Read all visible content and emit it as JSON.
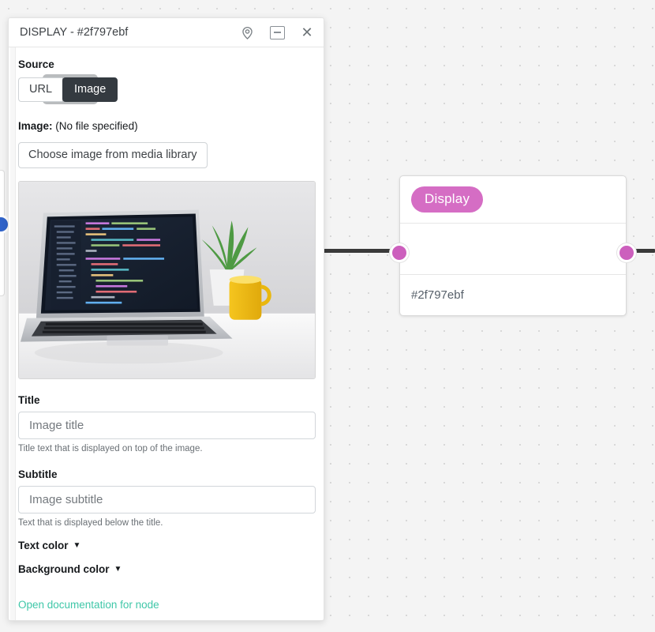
{
  "panel": {
    "title": "DISPLAY - #2f797ebf",
    "icons": {
      "locate": "location-pin-icon",
      "minimize": "minimize-window-icon",
      "close": "close-icon"
    },
    "source": {
      "label": "Source",
      "options": [
        "URL",
        "Image"
      ],
      "selected": "Image"
    },
    "file": {
      "label": "Image:",
      "value": "(No file specified)"
    },
    "media_button": "Choose image from media library",
    "preview": {
      "alt": "Laptop on white desk showing a code editor, with a green potted plant and a yellow mug"
    },
    "title_field": {
      "label": "Title",
      "value": "",
      "placeholder": "Image title",
      "helper": "Title text that is displayed on top of the image."
    },
    "subtitle_field": {
      "label": "Subtitle",
      "value": "",
      "placeholder": "Image subtitle",
      "helper": "Text that is displayed below the title."
    },
    "text_color": {
      "label": "Text color",
      "caret": "▼"
    },
    "background_color": {
      "label": "Background color",
      "caret": "▼"
    },
    "doc_link": "Open documentation for node",
    "uuid": "2f797ebf-c9ad-42f4-aa87-27b9cbe32686"
  },
  "node": {
    "badge": "Display",
    "id_label": "#2f797ebf"
  },
  "colors": {
    "badge": "#d56dc4",
    "port": "#cc5fbd",
    "port_orphan": "#3063c9",
    "edge": "#3a3a3a",
    "doc_link": "#3fc7a8",
    "toggle_selected_bg": "#343a40",
    "canvas_bg": "#f4f4f4",
    "canvas_dot": "#d8d8d8"
  }
}
